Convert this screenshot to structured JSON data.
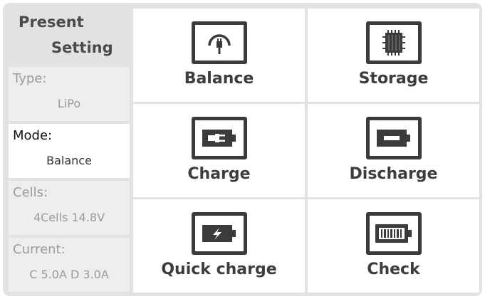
{
  "sidebar": {
    "title_line1": "Present",
    "title_line2": "Setting",
    "items": [
      {
        "label": "Type:",
        "value": "LiPo"
      },
      {
        "label": "Mode:",
        "value": "Balance"
      },
      {
        "label": "Cells:",
        "value": "4Cells 14.8V"
      },
      {
        "label": "Current:",
        "value": "C 5.0A D 3.0A"
      }
    ]
  },
  "modes": [
    {
      "label": "Balance",
      "icon": "plug-icon"
    },
    {
      "label": "Storage",
      "icon": "battery-storage-icon"
    },
    {
      "label": "Charge",
      "icon": "battery-charge-icon"
    },
    {
      "label": "Discharge",
      "icon": "battery-discharge-icon"
    },
    {
      "label": "Quick charge",
      "icon": "battery-bolt-icon"
    },
    {
      "label": "Check",
      "icon": "battery-check-icon"
    }
  ],
  "colors": {
    "icon_dark": "#3b3b3b",
    "frame": "#e2e2e2",
    "text": "#3d3d3d"
  }
}
